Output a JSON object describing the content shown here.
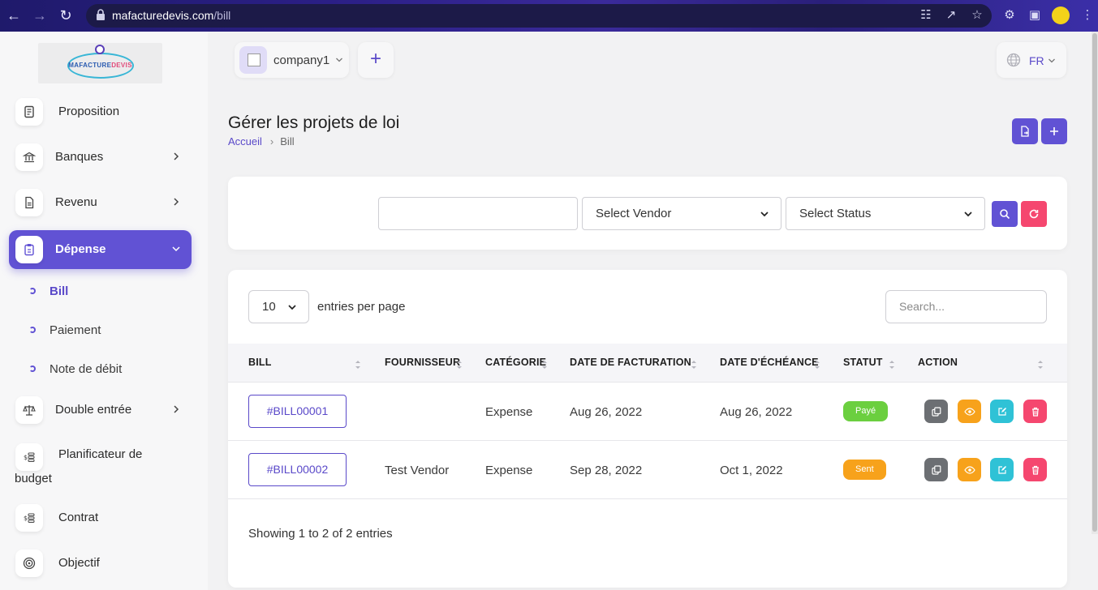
{
  "browser": {
    "url_domain": "mafacturedevis.com",
    "url_path": "/bill"
  },
  "logo": {
    "part1": "MAFACTURE",
    "part2": "DEVIS"
  },
  "sidebar": {
    "items": [
      {
        "label": "Proposition",
        "icon": "document-icon"
      },
      {
        "label": "Banques",
        "icon": "bank-icon"
      },
      {
        "label": "Revenu",
        "icon": "file-icon"
      },
      {
        "label": "Dépense",
        "icon": "clipboard-icon"
      },
      {
        "label": "Double entrée",
        "icon": "scale-icon"
      },
      {
        "label_line1": "Planificateur de",
        "label_line2": "budget",
        "icon": "budget-icon"
      },
      {
        "label": "Contrat",
        "icon": "contract-icon"
      },
      {
        "label": "Objectif",
        "icon": "target-icon"
      }
    ],
    "sub_items": [
      {
        "label": "Bill"
      },
      {
        "label": "Paiement"
      },
      {
        "label": "Note de débit"
      }
    ]
  },
  "topbar": {
    "company": "company1",
    "language": "FR"
  },
  "page": {
    "title": "Gérer les projets de loi",
    "breadcrumb_home": "Accueil",
    "breadcrumb_current": "Bill"
  },
  "filters": {
    "text_value": "",
    "vendor": "Select Vendor",
    "status": "Select Status"
  },
  "table": {
    "entries": "10",
    "entries_label": "entries per page",
    "search_placeholder": "Search...",
    "columns": [
      "BILL",
      "FOURNISSEUR",
      "CATÉGORIE",
      "DATE DE FACTURATION",
      "DATE D'ÉCHÉANCE",
      "STATUT",
      "ACTION"
    ],
    "rows": [
      {
        "bill": "#BILL00001",
        "vendor": "",
        "category": "Expense",
        "bill_date": "Aug 26, 2022",
        "due_date": "Aug 26, 2022",
        "status": "Payé",
        "status_color": "#6bcf3f"
      },
      {
        "bill": "#BILL00002",
        "vendor": "Test Vendor",
        "category": "Expense",
        "bill_date": "Sep 28, 2022",
        "due_date": "Oct 1, 2022",
        "status": "Sent",
        "status_color": "#f7a21b"
      }
    ],
    "footer": "Showing 1 to 2 of 2 entries"
  },
  "colors": {
    "primary": "#6152d4",
    "danger": "#f5476f",
    "warning": "#f7a21b",
    "info": "#2fc2d6",
    "secondary": "#6c6f73"
  }
}
